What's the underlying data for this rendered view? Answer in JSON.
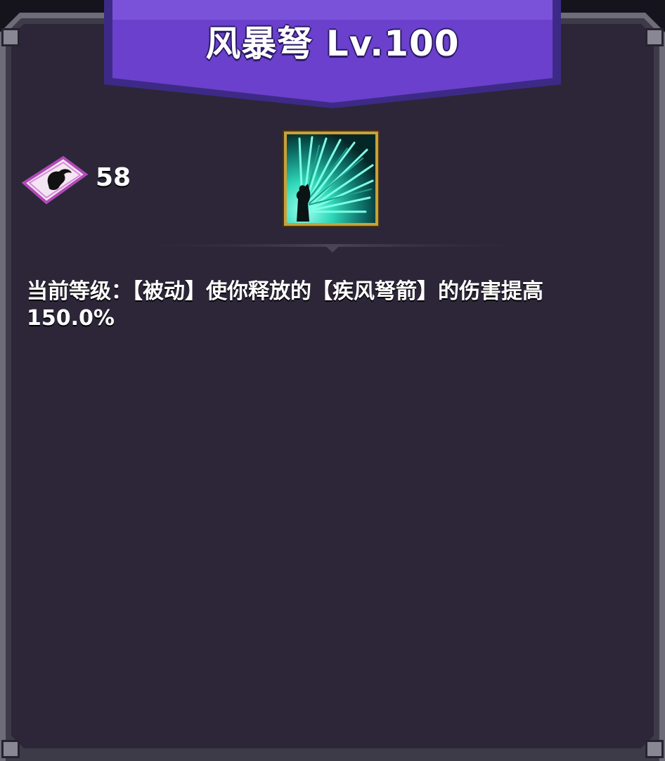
{
  "header": {
    "title": "风暴弩 Lv.100"
  },
  "resource": {
    "icon": "summon-ticket-icon",
    "count": "58"
  },
  "skill": {
    "icon": "arrow-storm-skill-icon"
  },
  "description": {
    "line1": "当前等级：【被动】使你释放的【疾风弩箭】的伤害提高",
    "line2": "150.0%"
  },
  "colors": {
    "ribbon": "#6a40cc",
    "panel": "#2c2638",
    "frame": "#6f6c7a",
    "icon_border": "#c8a03c",
    "icon_glow": "#3de0c0"
  }
}
